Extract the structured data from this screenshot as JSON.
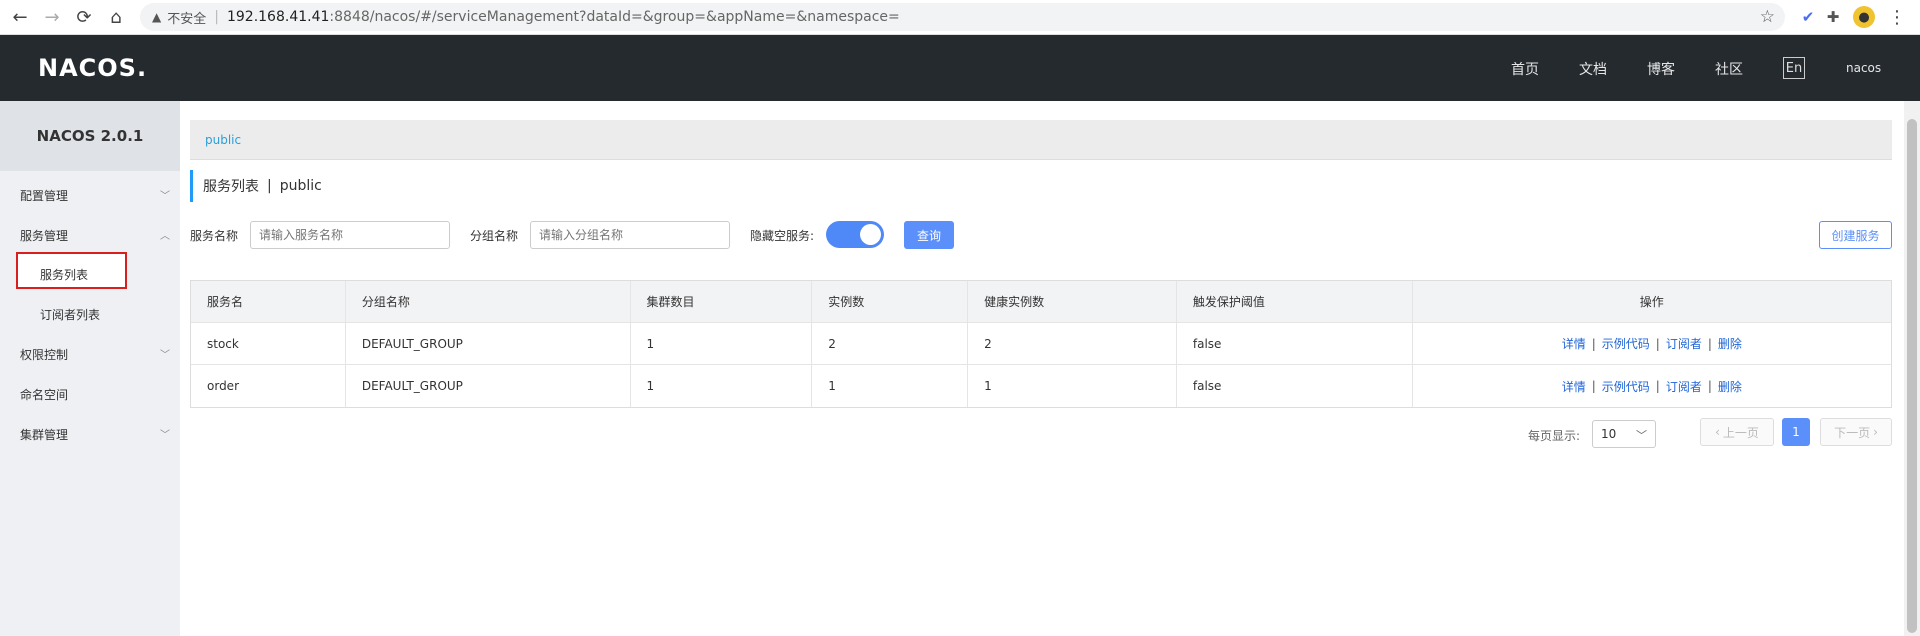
{
  "browser": {
    "back_icon": "←",
    "forward_icon": "→",
    "reload_icon": "⟳",
    "home_icon": "⌂",
    "insecure_label": "不安全",
    "url_host": "192.168.41.41",
    "url_rest": ":8848/nacos/#/serviceManagement?dataId=&group=&appName=&namespace=",
    "star_icon": "☆",
    "menu_icon": "⋮"
  },
  "header": {
    "logo": "NACOS.",
    "nav": [
      "首页",
      "文档",
      "博客",
      "社区"
    ],
    "lang": "En",
    "user": "nacos"
  },
  "sidebar": {
    "version": "NACOS 2.0.1",
    "items": [
      {
        "label": "配置管理"
      },
      {
        "label": "服务管理"
      },
      {
        "label": "服务列表"
      },
      {
        "label": "订阅者列表"
      },
      {
        "label": "权限控制"
      },
      {
        "label": "命名空间"
      },
      {
        "label": "集群管理"
      }
    ]
  },
  "main": {
    "namespace_tab": "public",
    "title": "服务列表",
    "title_sep": "|",
    "title_ns": "public",
    "filters": {
      "service_label": "服务名称",
      "service_placeholder": "请输入服务名称",
      "group_label": "分组名称",
      "group_placeholder": "请输入分组名称",
      "hide_empty_label": "隐藏空服务:",
      "hide_empty_on": true,
      "query_button": "查询",
      "create_button": "创建服务"
    },
    "table": {
      "columns": [
        "服务名",
        "分组名称",
        "集群数目",
        "实例数",
        "健康实例数",
        "触发保护阈值",
        "操作"
      ],
      "rows": [
        {
          "name": "stock",
          "group": "DEFAULT_GROUP",
          "clusters": "1",
          "instances": "2",
          "healthy": "2",
          "threshold": "false"
        },
        {
          "name": "order",
          "group": "DEFAULT_GROUP",
          "clusters": "1",
          "instances": "1",
          "healthy": "1",
          "threshold": "false"
        }
      ],
      "ops": [
        "详情",
        "示例代码",
        "订阅者",
        "删除"
      ]
    },
    "pagination": {
      "per_page_label": "每页显示:",
      "per_page_value": "10",
      "prev": "上一页",
      "current": "1",
      "next": "下一页"
    }
  },
  "colors": {
    "header_bg": "#252a2f",
    "primary": "#5b8ff9",
    "link": "#2065d8",
    "highlight_border": "#d81e1e"
  }
}
